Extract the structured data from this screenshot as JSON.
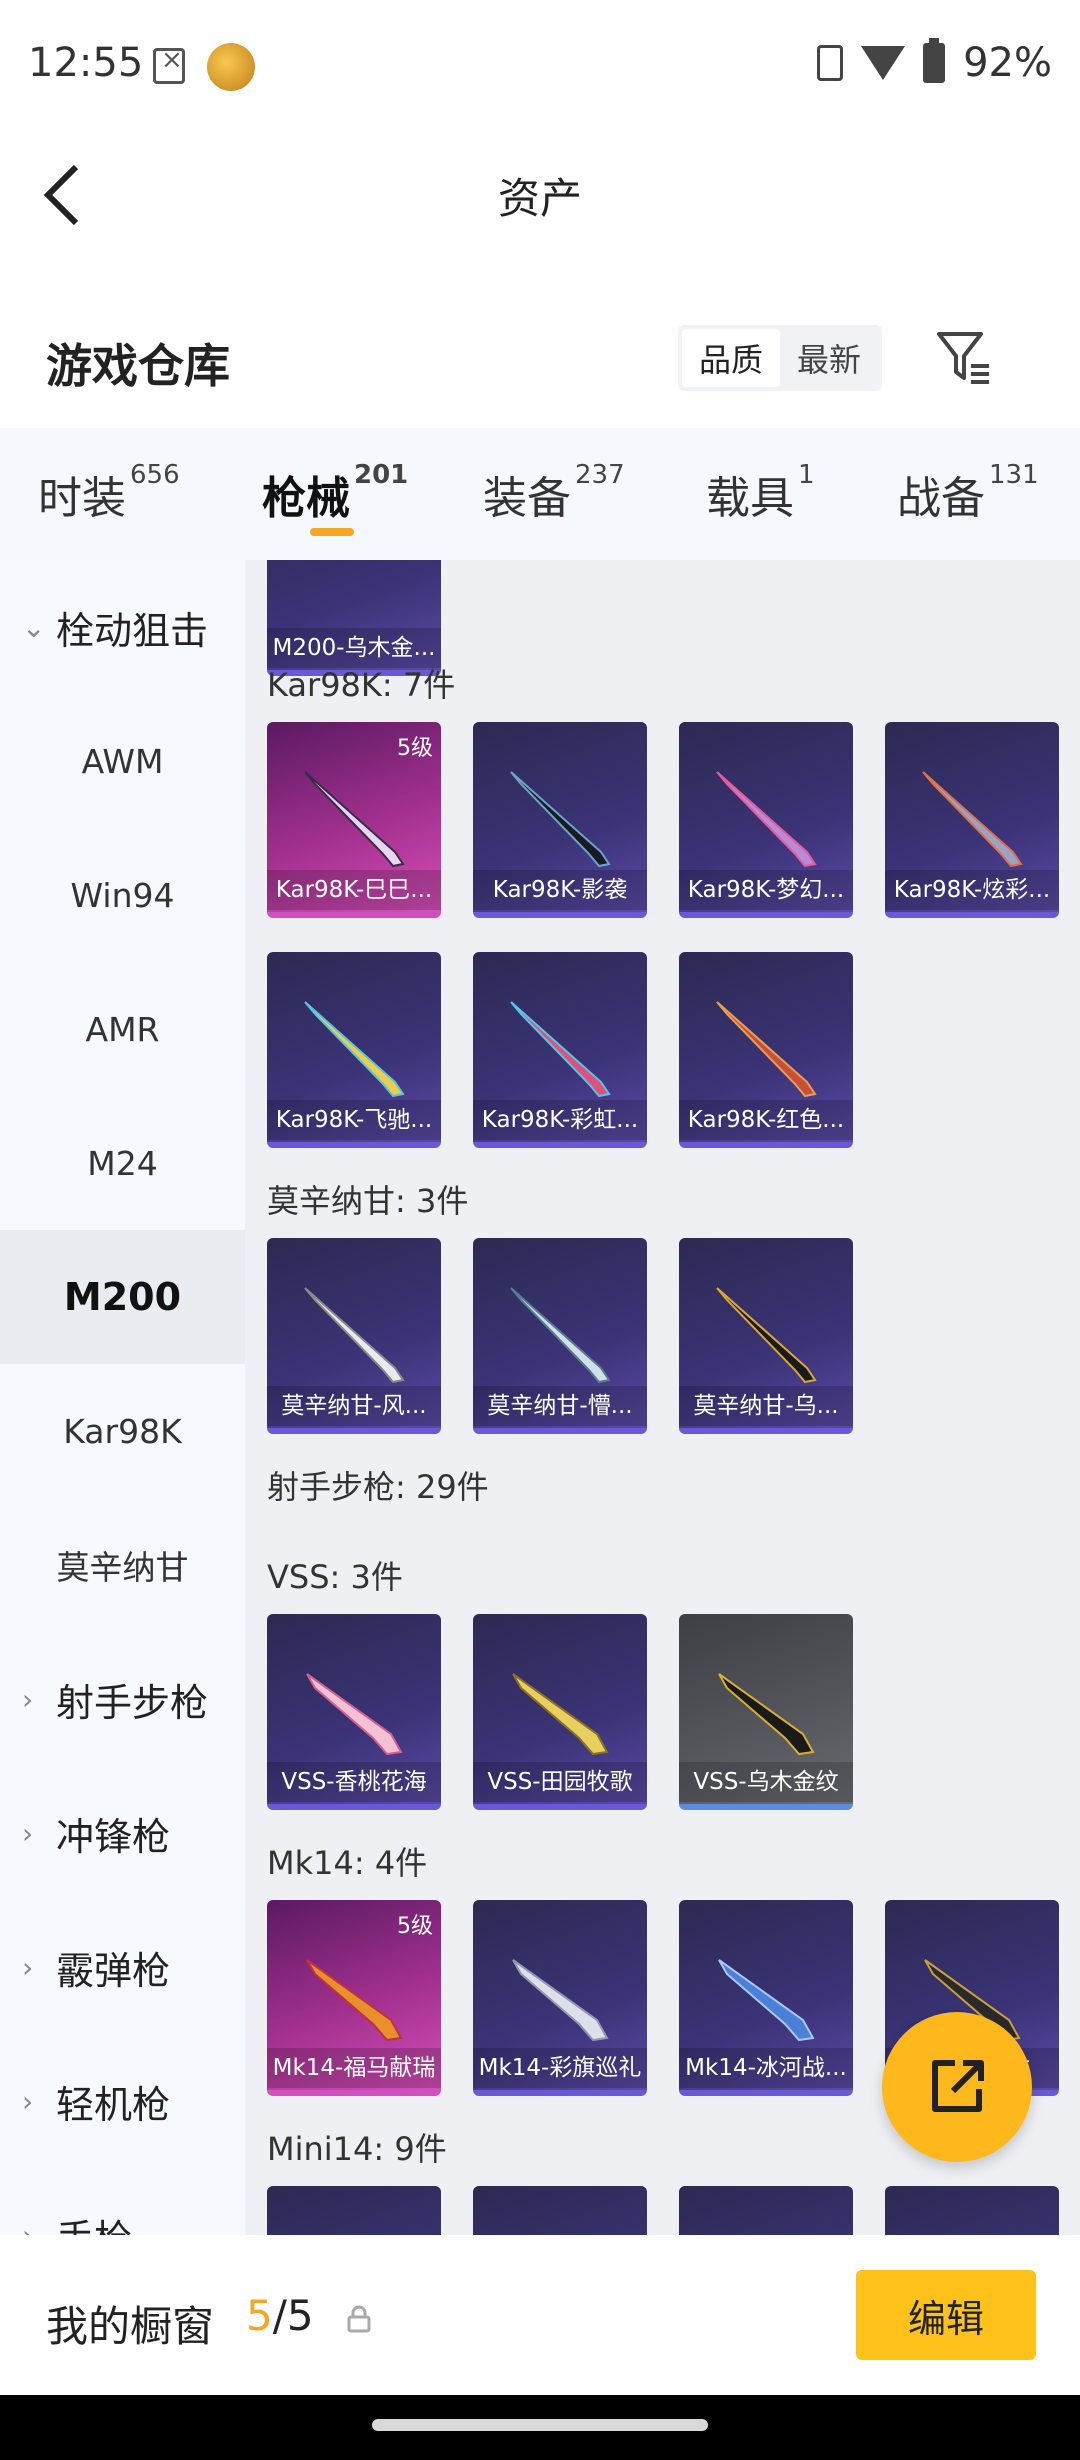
{
  "status_bar": {
    "time": "12:55",
    "battery": "92%",
    "icons": [
      "sim-off-icon",
      "app-icon",
      "vibrate-icon",
      "wifi-icon",
      "battery-icon"
    ]
  },
  "header": {
    "title": "资产",
    "back_icon": "chevron-left-icon"
  },
  "warehouse": {
    "title": "游戏仓库",
    "sort_options": [
      "品质",
      "最新"
    ],
    "active_sort": "品质",
    "filter_icon": "filter-icon"
  },
  "tabs": [
    {
      "label": "时装",
      "count": "656"
    },
    {
      "label": "枪械",
      "count": "201"
    },
    {
      "label": "装备",
      "count": "237"
    },
    {
      "label": "载具",
      "count": "1"
    },
    {
      "label": "战备",
      "count": "131"
    }
  ],
  "active_tab": "枪械",
  "accent_color": "#f5a623",
  "sidebar": [
    {
      "label": "栓动狙击",
      "type": "group",
      "expanded": true
    },
    {
      "label": "AWM",
      "type": "sub"
    },
    {
      "label": "Win94",
      "type": "sub"
    },
    {
      "label": "AMR",
      "type": "sub"
    },
    {
      "label": "M24",
      "type": "sub"
    },
    {
      "label": "M200",
      "type": "sub",
      "active": true
    },
    {
      "label": "Kar98K",
      "type": "sub"
    },
    {
      "label": "莫辛纳甘",
      "type": "sub"
    },
    {
      "label": "射手步枪",
      "type": "group"
    },
    {
      "label": "冲锋枪",
      "type": "group"
    },
    {
      "label": "霰弹枪",
      "type": "group"
    },
    {
      "label": "轻机枪",
      "type": "group"
    },
    {
      "label": "手枪",
      "type": "group"
    }
  ],
  "content": {
    "top_partial_card": "M200-乌木金...",
    "sections": [
      {
        "label": "Kar98K: 7件",
        "items": [
          {
            "name": "Kar98K-巳巳...",
            "level": "5级",
            "rarity": "pink"
          },
          {
            "name": "Kar98K-影袭",
            "rarity": "purple"
          },
          {
            "name": "Kar98K-梦幻...",
            "rarity": "purple"
          },
          {
            "name": "Kar98K-炫彩...",
            "rarity": "purple"
          },
          {
            "name": "Kar98K-飞驰...",
            "rarity": "purple"
          },
          {
            "name": "Kar98K-彩虹...",
            "rarity": "purple"
          },
          {
            "name": "Kar98K-红色...",
            "rarity": "purple"
          }
        ]
      },
      {
        "label": "莫辛纳甘: 3件",
        "items": [
          {
            "name": "莫辛纳甘-风...",
            "rarity": "purple"
          },
          {
            "name": "莫辛纳甘-懵...",
            "rarity": "purple"
          },
          {
            "name": "莫辛纳甘-乌...",
            "rarity": "purple"
          }
        ]
      },
      {
        "label": "射手步枪: 29件",
        "items": []
      },
      {
        "label": "VSS: 3件",
        "items": [
          {
            "name": "VSS-香桃花海",
            "rarity": "purple"
          },
          {
            "name": "VSS-田园牧歌",
            "rarity": "purple"
          },
          {
            "name": "VSS-乌木金纹",
            "rarity": "gray"
          }
        ]
      },
      {
        "label": "Mk14: 4件",
        "items": [
          {
            "name": "Mk14-福马献瑞",
            "level": "5级",
            "rarity": "pink"
          },
          {
            "name": "Mk14-彩旗巡礼",
            "rarity": "purple"
          },
          {
            "name": "Mk14-冰河战...",
            "rarity": "purple"
          },
          {
            "name": "Mk14-...纹",
            "rarity": "purple"
          }
        ]
      },
      {
        "label": "Mini14: 9件",
        "items": []
      }
    ]
  },
  "bottom_bar": {
    "window_label": "我的橱窗",
    "window_current": "5",
    "window_total": "/5",
    "edit_label": "编辑"
  },
  "fab_icon": "share-icon"
}
